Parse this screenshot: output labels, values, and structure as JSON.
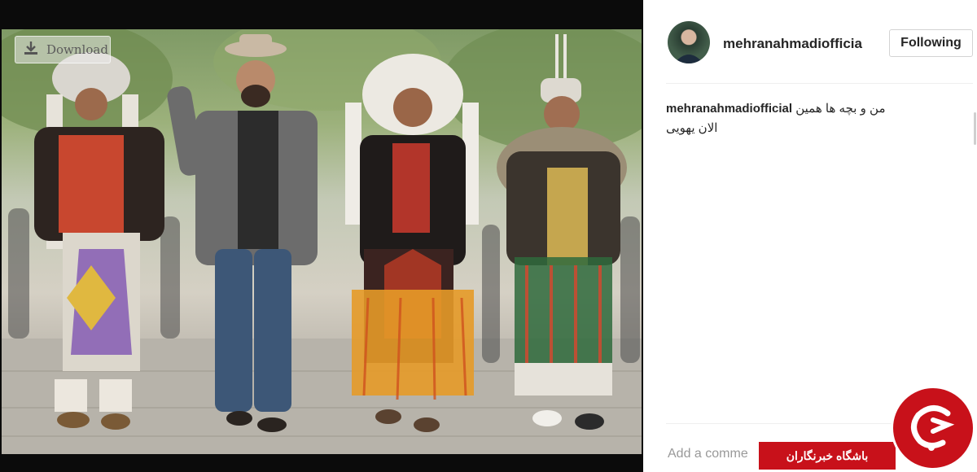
{
  "viewer": {
    "download_label": "Download",
    "download_icon": "download-icon"
  },
  "post": {
    "username": "mehranahmadiofficia",
    "follow_label": "Following",
    "caption_user": "mehranahmadiofficial",
    "caption_text_line1": "من و بچه ها همین",
    "caption_text_line2": "الان یهویی",
    "comment_placeholder": "Add a comme"
  },
  "watermark": {
    "text": "باشگاه خبرنگاران"
  },
  "colors": {
    "brand_red": "#c8111a",
    "text_dark": "#262626",
    "placeholder_gray": "#999999"
  }
}
